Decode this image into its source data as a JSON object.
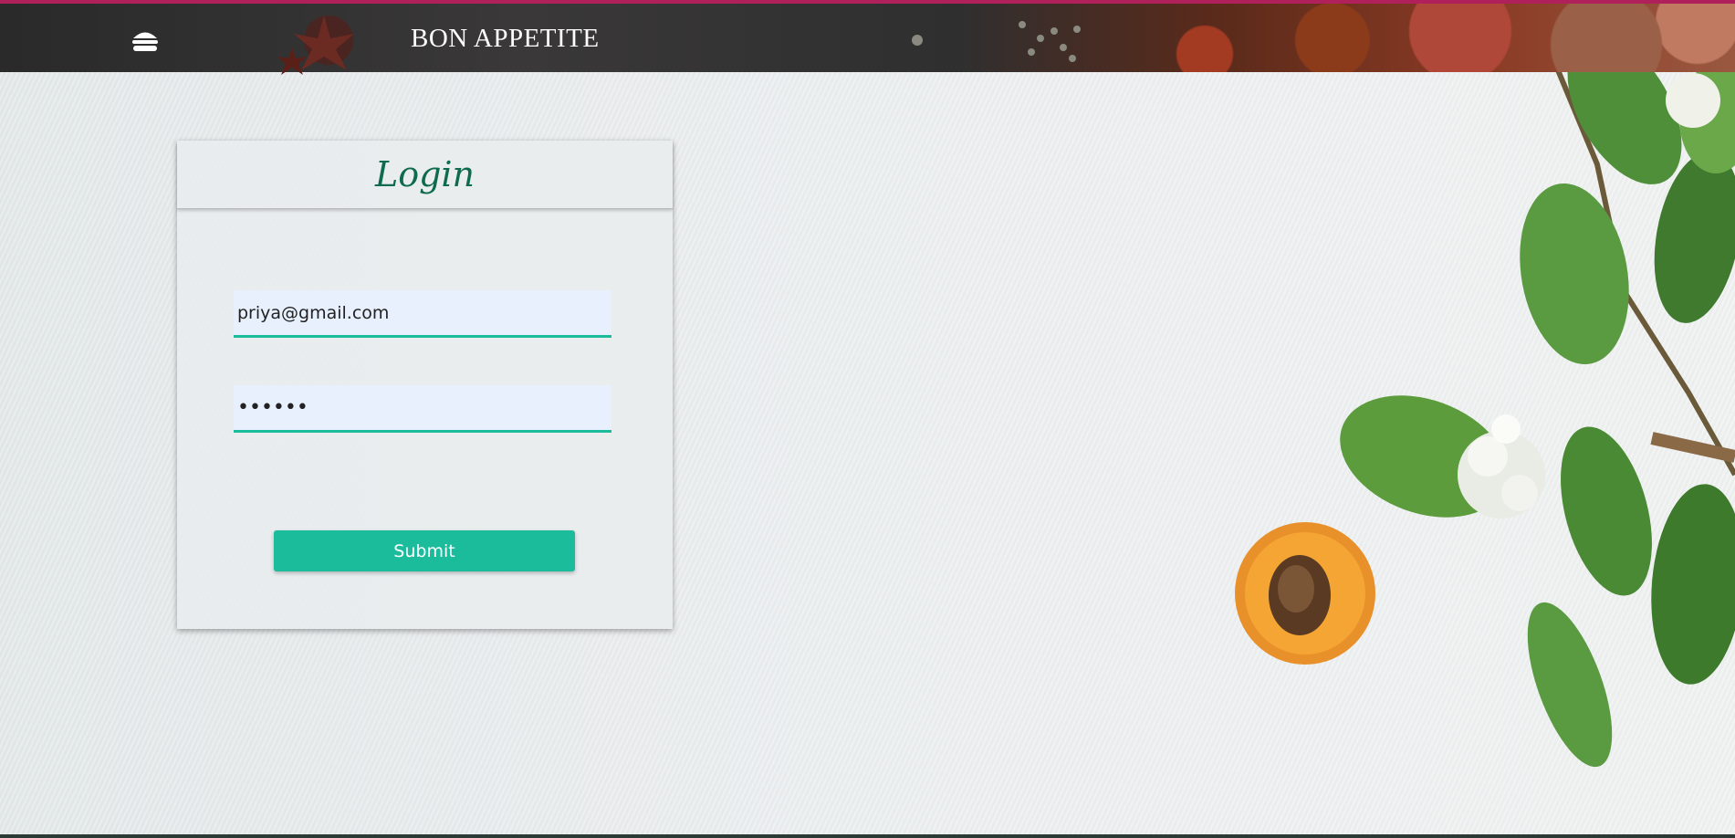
{
  "header": {
    "brand": "BON APPETITE",
    "menu_icon": "hamburger-icon",
    "accent_color": "#b0205a"
  },
  "login": {
    "title": "Login",
    "email_value": "priya@gmail.com",
    "password_value": "••••••",
    "submit_label": "Submit",
    "title_color": "#0e6b4e",
    "accent_color": "#1abc9c"
  }
}
